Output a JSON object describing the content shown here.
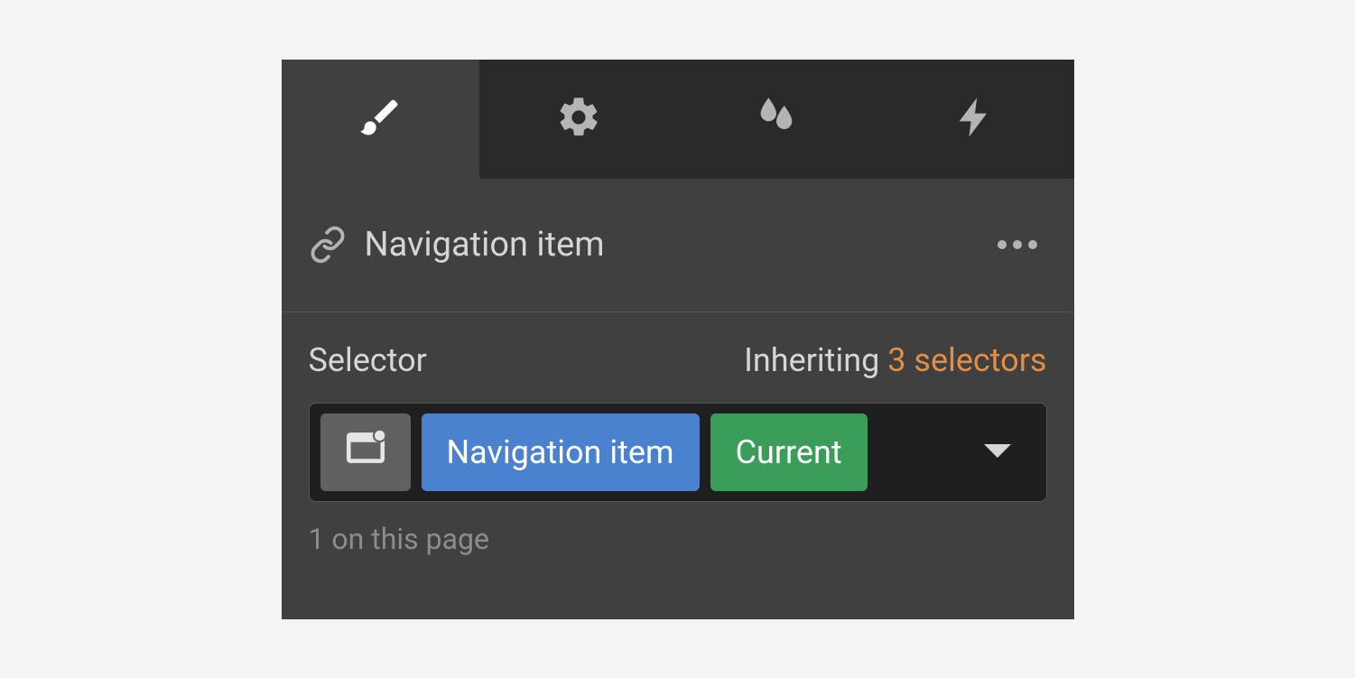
{
  "tabs": {
    "style_icon": "brush-icon",
    "settings_icon": "gear-icon",
    "effects_icon": "droplets-icon",
    "interactions_icon": "bolt-icon",
    "active_index": 0
  },
  "element": {
    "icon": "link-icon",
    "label": "Navigation item",
    "more_icon": "more-horizontal-icon"
  },
  "selector": {
    "title": "Selector",
    "inheriting_label": "Inheriting",
    "inheriting_count_label": "3 selectors",
    "element_chip_icon": "element-box-icon",
    "class_chip_label": "Navigation item",
    "state_chip_label": "Current",
    "dropdown_icon": "chevron-down-icon",
    "count_line": "1 on this page"
  },
  "colors": {
    "panel_bg": "#404040",
    "tab_inactive_bg": "#2a2a2a",
    "accent_orange": "#e38d45",
    "class_blue": "#4a82d0",
    "state_green": "#3a9d5a",
    "field_bg": "#1f1f1f"
  }
}
